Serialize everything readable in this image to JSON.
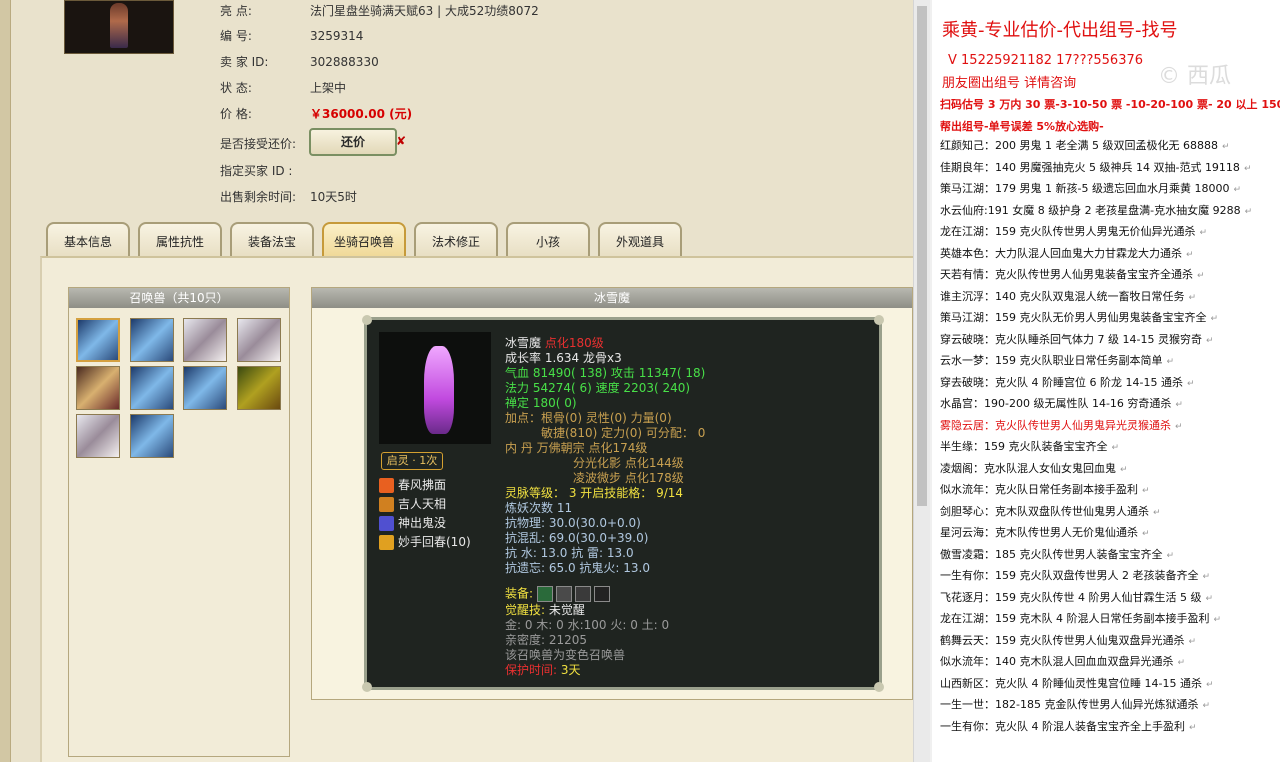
{
  "account": {
    "highlights_label": "亮        点:",
    "highlights_value": "法门星盘坐骑满天赋63 | 大成52功绩8072",
    "id_label": "编        号:",
    "id_value": "3259314",
    "seller_label": "卖    家    ID:",
    "seller_value": "302888330",
    "status_label": "状        态:",
    "status_value": "上架中",
    "price_label": "价        格:",
    "price_value": "￥36000.00 (元)",
    "counter_label": "是否接受还价:",
    "counter_button": "还价",
    "counter_x": "✘",
    "buyer_label": "指定买家 ID :",
    "remaining_label": "出售剩余时间:",
    "remaining_value": "10天5时"
  },
  "tabs": [
    "基本信息",
    "属性抗性",
    "装备法宝",
    "坐骑召唤兽",
    "法术修正",
    "小孩",
    "外观道具"
  ],
  "active_tab": "坐骑召唤兽",
  "pets": {
    "header": "召唤兽（共10只）"
  },
  "detail": {
    "header": "冰雪魔",
    "awaken_badge": "启灵 · 1次",
    "skills": [
      "春风拂面",
      "吉人天相",
      "神出鬼没",
      "妙手回春(10)"
    ],
    "name_line": "冰雪魔",
    "name_refine": " 点化180级",
    "growth": "成长率 1.634 龙骨x3",
    "hp_attack": "气血 81490( 138) 攻击 11347( 18)",
    "mp_speed": "法力 54274( 6) 速度 2203( 240)",
    "zen": "禅定 180( 0)",
    "points_line1": "加点：根骨(0) 灵性(0) 力量(0)",
    "points_line2": "敏捷(810) 定力(0) 可分配： 0",
    "inner_line1": "内    丹 万佛朝宗 点化174级",
    "inner_line2": "分光化影 点化144级",
    "inner_line3": "凌波微步 点化178级",
    "spirit_level": "灵脉等级： 3 开启技能格： 9/14",
    "refine_count": "炼妖次数 11",
    "res_phys": "抗物理: 30.0(30.0+0.0)",
    "res_chaos": "抗混乱: 69.0(30.0+39.0)",
    "res_water_thunder": "抗  水: 13.0 抗  雷: 13.0",
    "res_forget_ghost": "抗遗忘: 65.0 抗鬼火: 13.0",
    "equip_label": "装备:",
    "awaken_label": "觉醒技:",
    "awaken_value": "未觉醒",
    "elements": "金: 0 木: 0 水:100 火: 0 土: 0",
    "intimacy": "亲密度: 21205",
    "transform_note": "该召唤兽为变色召唤兽",
    "protect_label": "保护时间:",
    "protect_value": "3天"
  },
  "ads": {
    "title": "乘黄-专业估价-代出组号-找号",
    "phone": "V 15225921182    17???556376",
    "circle": "朋友圈出组号    详情咨询",
    "watermark": "© 西瓜",
    "scan": "扫码估号 3 万内 30 票-3-10-50 票  -10-20-100 票- 20 以上 150",
    "help": "帮出组号-单号误差 5%放心选购-",
    "lines": [
      {
        "text": "红颜知己：200 男鬼 1 老全满 5 级双回孟极化无  68888",
        "red": false
      },
      {
        "text": "佳期良年：140 男魔强抽克火 5 级神兵 14 双抽-范式 19118",
        "red": false
      },
      {
        "text": "策马江湖：179 男鬼 1 新孩-5 级遗忘回血水月乘黄 18000",
        "red": false
      },
      {
        "text": "水云仙府:191 女魔 8 级护身 2 老孩星盘满-克水抽女魔  9288",
        "red": false
      },
      {
        "text": "龙在江湖：159 克火队传世男人男鬼无价仙异光通杀",
        "red": false
      },
      {
        "text": "英雄本色：大力队混人回血鬼大力甘霖龙大力通杀",
        "red": false
      },
      {
        "text": "天若有情：克火队传世男人仙男鬼装备宝宝齐全通杀",
        "red": false
      },
      {
        "text": "谁主沉浮：140 克火队双鬼混人统一畜牧日常任务",
        "red": false
      },
      {
        "text": "策马江湖：159 克火队无价男人男仙男鬼装备宝宝齐全",
        "red": false
      },
      {
        "text": "穿云破晓：克火队睡杀回气体力 7 级 14-15 灵猴穷奇",
        "red": false
      },
      {
        "text": "云水一梦：159 克火队职业日常任务副本简单",
        "red": false
      },
      {
        "text": "穿去破晓：克火队 4 阶睡宫位 6 阶龙 14-15 通杀",
        "red": false
      },
      {
        "text": "水晶宫：190-200 级无属性队 14-16 穷奇通杀",
        "red": false
      },
      {
        "text": "雾隐云居：克火队传世男人仙男鬼异光灵猴通杀",
        "red": true
      },
      {
        "text": "半生缘：159 克火队装备宝宝齐全",
        "red": false
      },
      {
        "text": "凌烟阁：克水队混人女仙女鬼回血鬼",
        "red": false
      },
      {
        "text": "似水流年：克火队日常任务副本接手盈利",
        "red": false
      },
      {
        "text": "剑胆琴心：克木队双盘队传世仙鬼男人通杀",
        "red": false
      },
      {
        "text": "星河云海：克木队传世男人无价鬼仙通杀",
        "red": false
      },
      {
        "text": "傲雪凌霜：185 克火队传世男人装备宝宝齐全",
        "red": false
      },
      {
        "text": "一生有你：159 克火队双盘传世男人 2 老孩装备齐全",
        "red": false
      },
      {
        "text": "飞花逐月：159 克火队传世 4 阶男人仙甘霖生活 5 级",
        "red": false
      },
      {
        "text": "龙在江湖：159 克木队 4 阶混人日常任务副本接手盈利",
        "red": false
      },
      {
        "text": "鹤舞云天：159 克火队传世男人仙鬼双盘异光通杀",
        "red": false
      },
      {
        "text": "似水流年：140 克木队混人回血血双盘异光通杀",
        "red": false
      },
      {
        "text": "山西新区：克火队 4 阶睡仙灵性鬼宫位睡 14-15 通杀",
        "red": false
      },
      {
        "text": "一生一世：182-185 克金队传世男人仙异光炼狱通杀",
        "red": false
      },
      {
        "text": "一生有你：克火队 4 阶混人装备宝宝齐全上手盈利",
        "red": false
      }
    ],
    "return_mark": "↵"
  }
}
